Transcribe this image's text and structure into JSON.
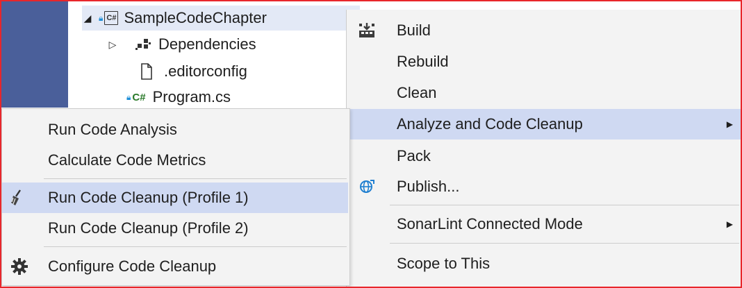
{
  "solution_explorer": {
    "project": "SampleCodeChapter",
    "items": [
      {
        "label": "Dependencies",
        "icon": "dependencies-icon"
      },
      {
        "label": ".editorconfig",
        "icon": "file-icon"
      },
      {
        "label": "Program.cs",
        "icon": "csharp-file-icon"
      }
    ],
    "cs_badge": "C#"
  },
  "context_menu": {
    "items": [
      {
        "label": "Build",
        "icon": "build-icon"
      },
      {
        "label": "Rebuild"
      },
      {
        "label": "Clean"
      },
      {
        "label": "Analyze and Code Cleanup",
        "submenu": true,
        "highlighted": true
      },
      {
        "label": "Pack"
      },
      {
        "label": "Publish...",
        "icon": "publish-globe-icon"
      },
      {
        "label": "SonarLint Connected Mode",
        "submenu": true
      },
      {
        "label": "Scope to This"
      }
    ]
  },
  "submenu": {
    "items": [
      {
        "label": "Run Code Analysis"
      },
      {
        "label": "Calculate Code Metrics"
      },
      {
        "label": "Run Code Cleanup (Profile 1)",
        "icon": "broom-icon",
        "highlighted": true
      },
      {
        "label": "Run Code Cleanup (Profile 2)"
      },
      {
        "label": "Configure Code Cleanup",
        "icon": "gear-icon"
      }
    ]
  },
  "colors": {
    "frame_border": "#e8262b",
    "sidebar": "#4a5f9a",
    "menu_bg": "#f3f3f3",
    "highlight": "#cfd9f2"
  }
}
